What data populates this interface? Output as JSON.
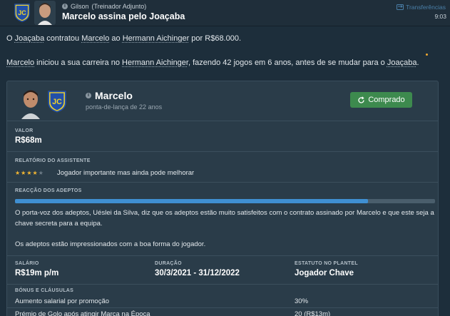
{
  "header": {
    "sender_name": "Gilson",
    "sender_role": "(Treinador Adjunto)",
    "subject": "Marcelo assina pelo Joaçaba",
    "category": "Transferências",
    "time": "9:03"
  },
  "message": {
    "p1": {
      "t1": "O ",
      "club": "Joaçaba",
      "t2": " contratou ",
      "player": "Marcelo",
      "t3": " ao ",
      "from": "Hermann Aichinger",
      "t4": " por R$68.000."
    },
    "p2": {
      "player": "Marcelo",
      "t1": " iniciou a sua carreira no ",
      "from": "Hermann Aichinger",
      "t2": ", fazendo 42 jogos em 6 anos, antes de se mudar para o ",
      "club": "Joaçaba",
      "t3": "."
    }
  },
  "card": {
    "player_name": "Marcelo",
    "player_desc": "ponta-de-lança de 22 anos",
    "status_button": "Comprado",
    "value_label": "VALOR",
    "value": "R$68m",
    "assessment_label": "RELATÓRIO DO ASSISTENTE",
    "assessment_stars": 4,
    "assessment_text": "Jogador importante mas ainda pode melhorar",
    "fans_label": "REACÇÃO DOS ADEPTOS",
    "fans_satisfaction": 0.84,
    "fans_text1": "O porta-voz dos adeptos, Uéslei da Silva, diz que os adeptos estão muito satisfeitos com o contrato assinado por Marcelo e que este seja a chave secreta para a equipa.",
    "fans_text2": "Os adeptos estão impressionados com a boa forma do jogador.",
    "contract": {
      "salary_label": "SALÁRIO",
      "salary": "R$19m p/m",
      "duration_label": "DURAÇÃO",
      "duration": "30/3/2021 - 31/12/2022",
      "status_label": "ESTATUTO NO PLANTEL",
      "status": "Jogador Chave"
    },
    "clauses_label": "BÓNUS E CLÁUSULAS",
    "clauses": [
      {
        "name": "Aumento salarial por promoção",
        "value": "30%"
      },
      {
        "name": "Prémio de Golo após atingir Marca na Época",
        "value": "20 (R$13m)"
      }
    ]
  },
  "colors": {
    "accent_blue": "#3f8fd2",
    "button_green": "#3d8a4e",
    "star_gold": "#f2b632",
    "badge_blue": "#2250a8",
    "badge_yellow": "#f1d22a"
  },
  "icons": {
    "club_badge": "club-badge-icon",
    "bought": "refresh-icon",
    "info": "info-icon",
    "category": "transfer-icon"
  }
}
